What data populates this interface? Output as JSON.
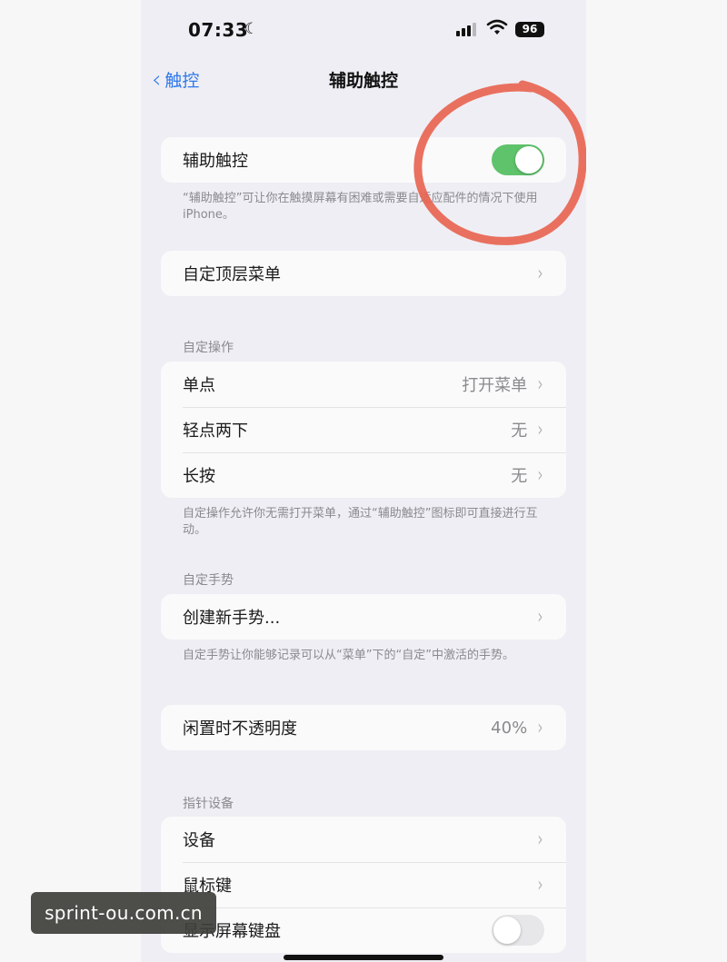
{
  "status_bar": {
    "time": "07:33",
    "battery": "96"
  },
  "nav": {
    "back_label": "触控",
    "title": "辅助触控"
  },
  "assistive_touch": {
    "label": "辅助触控",
    "toggle_on": true,
    "footnote": "“辅助触控”可让你在触摸屏幕有困难或需要自适应配件的情况下使用iPhone。"
  },
  "top_menu": {
    "label": "自定顶层菜单"
  },
  "custom_actions": {
    "header": "自定操作",
    "items": [
      {
        "label": "单点",
        "value": "打开菜单"
      },
      {
        "label": "轻点两下",
        "value": "无"
      },
      {
        "label": "长按",
        "value": "无"
      }
    ],
    "footnote": "自定操作允许你无需打开菜单，通过“辅助触控”图标即可直接进行互动。"
  },
  "custom_gestures": {
    "header": "自定手势",
    "item_label": "创建新手势...",
    "footnote": "自定手势让你能够记录可以从“菜单”下的“自定”中激活的手势。"
  },
  "idle_opacity": {
    "label": "闲置时不透明度",
    "value": "40%"
  },
  "pointer_devices": {
    "header": "指针设备",
    "items": [
      {
        "label": "设备"
      },
      {
        "label": "鼠标键"
      },
      {
        "label": "显示屏幕键盘",
        "toggle_on": false
      }
    ]
  },
  "watermark": "sprint-ou.com.cn",
  "colors": {
    "accent": "#2f79e8",
    "toggle_on": "#5fc36b",
    "annotation": "#e8624f"
  }
}
